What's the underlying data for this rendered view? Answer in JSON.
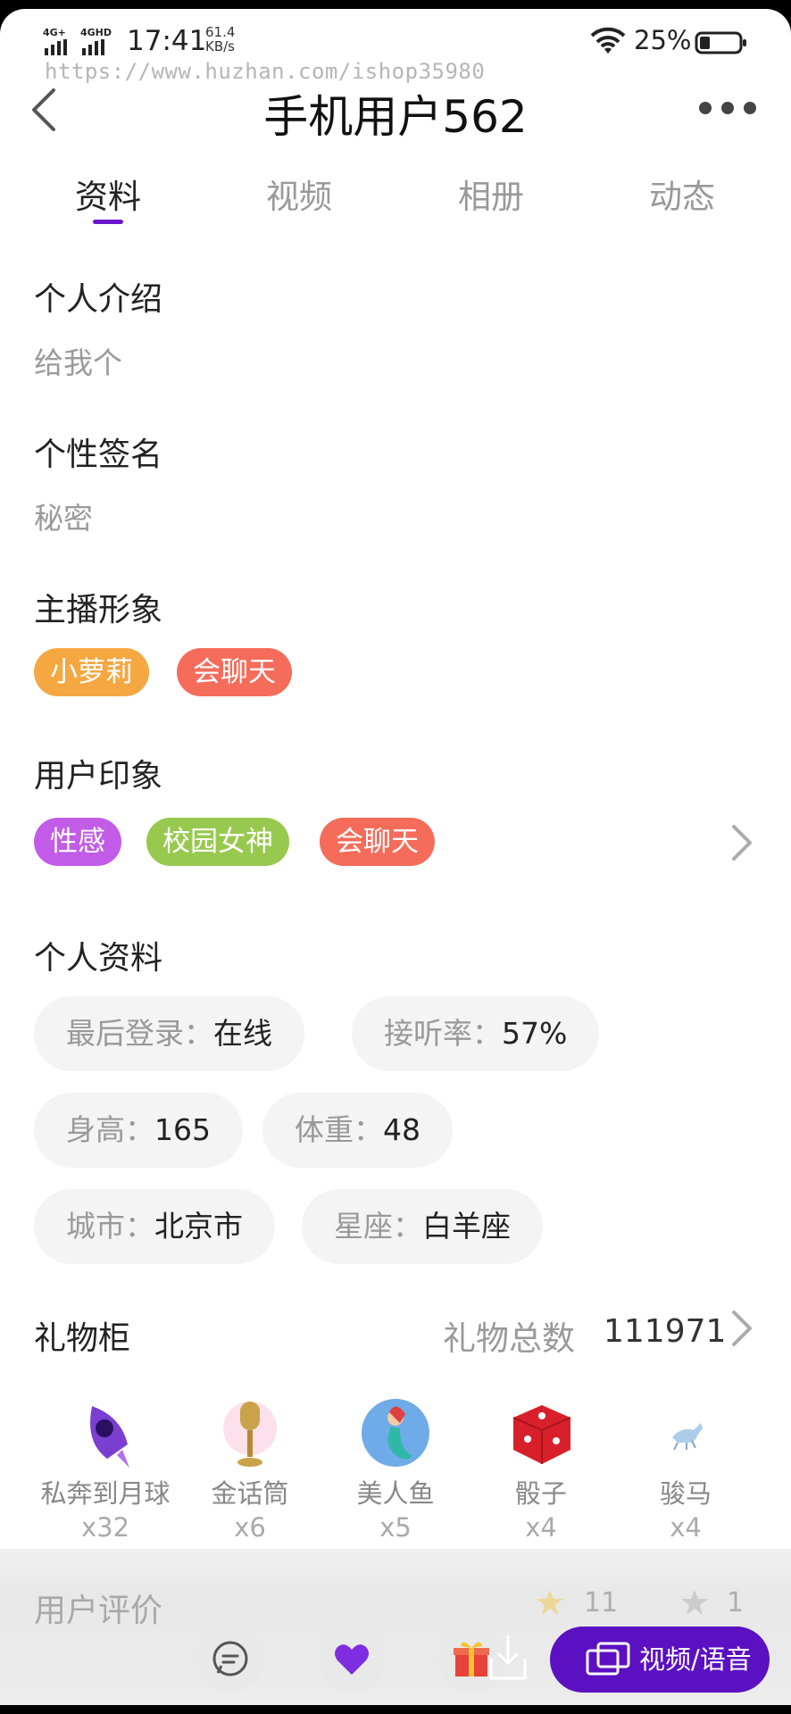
{
  "status_bar": {
    "signal_1": "4G+",
    "signal_2": "4GHD",
    "time": "17:41",
    "speed_value": "61.4",
    "speed_unit": "KB/s",
    "battery_pct": "25%"
  },
  "watermark": "https://www.huzhan.com/ishop35980",
  "header": {
    "title": "手机用户562"
  },
  "tabs": [
    {
      "label": "资料",
      "active": true
    },
    {
      "label": "视频",
      "active": false
    },
    {
      "label": "相册",
      "active": false
    },
    {
      "label": "动态",
      "active": false
    }
  ],
  "intro": {
    "title": "个人介绍",
    "text": "给我个"
  },
  "signature": {
    "title": "个性签名",
    "text": "秘密"
  },
  "anchor_image": {
    "title": "主播形象",
    "tags": [
      {
        "label": "小萝莉",
        "color": "#f5a742"
      },
      {
        "label": "会聊天",
        "color": "#f56c5a"
      }
    ]
  },
  "user_impression": {
    "title": "用户印象",
    "tags": [
      {
        "label": "性感",
        "color": "#c25ce8"
      },
      {
        "label": "校园女神",
        "color": "#97c94e"
      },
      {
        "label": "会聊天",
        "color": "#f56c5a"
      }
    ]
  },
  "profile": {
    "title": "个人资料",
    "items": [
      {
        "key": "最后登录：",
        "value": "在线"
      },
      {
        "key": "接听率：",
        "value": "57%"
      },
      {
        "key": "身高：",
        "value": "165"
      },
      {
        "key": "体重：",
        "value": "48"
      },
      {
        "key": "城市：",
        "value": "北京市"
      },
      {
        "key": "星座：",
        "value": "白羊座"
      }
    ]
  },
  "gift_cabinet": {
    "title": "礼物柜",
    "total_label": "礼物总数",
    "total_value": "111971",
    "gifts": [
      {
        "name": "私奔到月球",
        "count": "x32",
        "icon": "rocket-icon"
      },
      {
        "name": "金话筒",
        "count": "x6",
        "icon": "microphone-icon"
      },
      {
        "name": "美人鱼",
        "count": "x5",
        "icon": "mermaid-icon"
      },
      {
        "name": "骰子",
        "count": "x4",
        "icon": "dice-icon"
      },
      {
        "name": "骏马",
        "count": "x4",
        "icon": "horse-icon"
      }
    ]
  },
  "rating_peek": {
    "title": "用户评价",
    "good": "11",
    "bad": "1"
  },
  "bottom_bar": {
    "call_label": "视频/语音"
  },
  "colors": {
    "accent": "#6a14cc",
    "call_button": "#5b10c2"
  }
}
